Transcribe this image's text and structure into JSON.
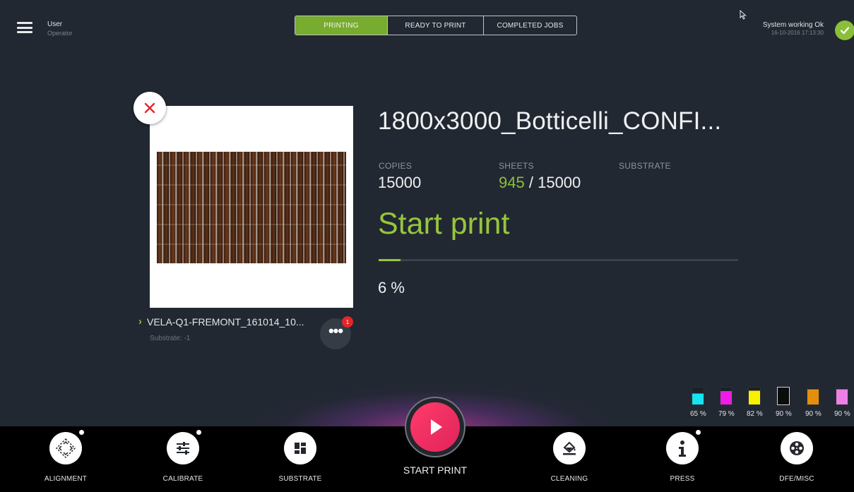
{
  "header": {
    "user_name": "User",
    "user_role": "Operator",
    "tabs": [
      {
        "label": "PRINTING",
        "active": true
      },
      {
        "label": "READY TO PRINT",
        "active": false
      },
      {
        "label": "COMPLETED JOBS",
        "active": false
      }
    ],
    "status_text": "System working Ok",
    "status_time": "16-10-2016 17:13:30"
  },
  "job": {
    "title": "1800x3000_Botticelli_CONFI...",
    "copies_label": "COPIES",
    "copies_value": "15000",
    "sheets_label": "SHEETS",
    "sheets_done": "945",
    "sheets_sep": "/",
    "sheets_total": "15000",
    "substrate_label": "SUBSTRATE",
    "state": "Start print",
    "progress_text": "6 %",
    "progress_fraction": 0.06,
    "file_name": "VELA-Q1-FREMONT_161014_10...",
    "file_substrate": "Substrate: -1",
    "notification_count": "1"
  },
  "inks": [
    {
      "color": "#17e3ef",
      "percent": "65 %",
      "level": 0.65
    },
    {
      "color": "#ee1ce5",
      "percent": "79 %",
      "level": 0.79
    },
    {
      "color": "#f7f100",
      "percent": "82 %",
      "level": 0.82
    },
    {
      "color": "#0c0c0c",
      "percent": "90 %",
      "level": 0.9
    },
    {
      "color": "#e48f0c",
      "percent": "90 %",
      "level": 0.9
    },
    {
      "color": "#ee7fe5",
      "percent": "90 %",
      "level": 0.9
    }
  ],
  "toolbar": {
    "alignment": "ALIGNMENT",
    "calibrate": "CALIBRATE",
    "substrate": "SUBSTRATE",
    "start_print": "START PRINT",
    "cleaning": "CLEANING",
    "press": "PRESS",
    "dfe_misc": "DFE/MISC"
  },
  "colors": {
    "background": "#222831",
    "accent": "#96c63c",
    "start_button": "#ff3b6b",
    "badge": "#e3262b"
  }
}
